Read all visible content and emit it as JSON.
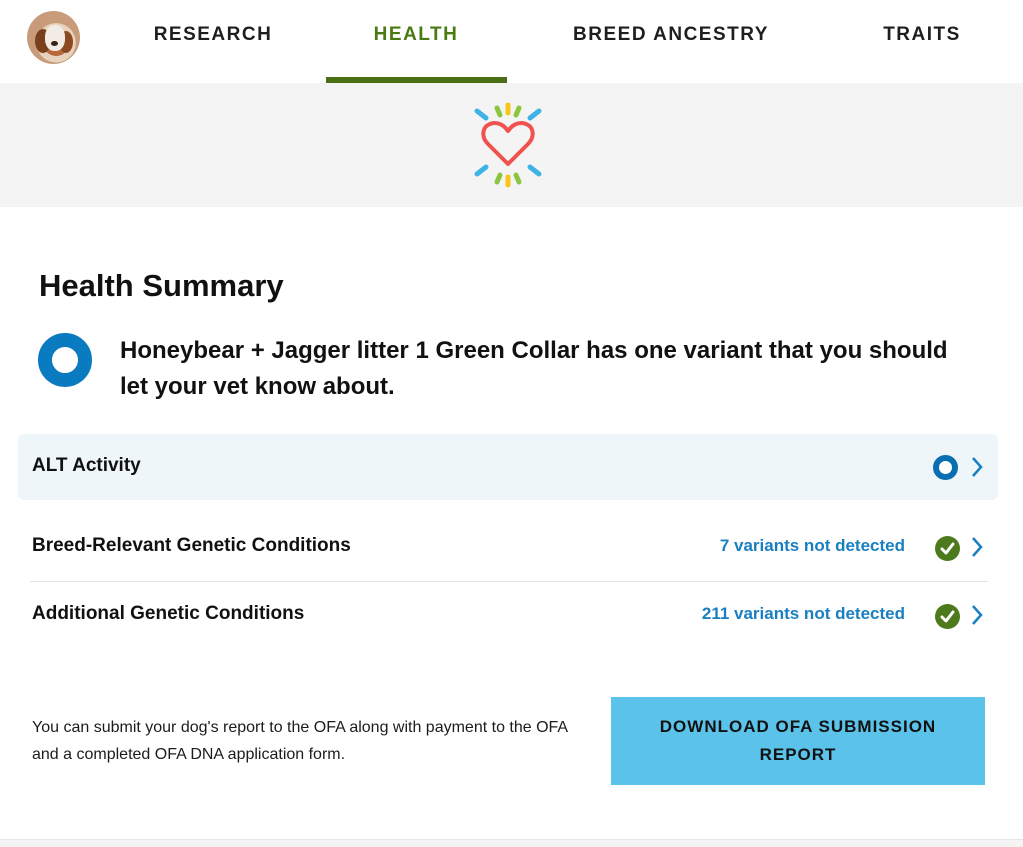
{
  "nav": {
    "tabs": [
      {
        "label": "RESEARCH",
        "active": false
      },
      {
        "label": "HEALTH",
        "active": true
      },
      {
        "label": "BREED ANCESTRY",
        "active": false
      },
      {
        "label": "TRAITS",
        "active": false
      }
    ]
  },
  "banner": {
    "icon": "heart-burst-icon"
  },
  "health": {
    "title": "Health Summary",
    "summary": "Honeybear + Jagger litter 1 Green Collar has one variant that you should let your vet know about."
  },
  "rows": [
    {
      "label": "ALT Activity",
      "count": "",
      "status": "notable"
    },
    {
      "label": "Breed-Relevant Genetic Conditions",
      "count": "7 variants not detected",
      "status": "clear"
    },
    {
      "label": "Additional Genetic Conditions",
      "count": "211 variants not detected",
      "status": "clear"
    }
  ],
  "ofa": {
    "text": "You can submit your dog's report to the OFA along with payment to the OFA and a completed OFA DNA application form.",
    "button_label": "DOWNLOAD OFA SUBMISSION REPORT"
  },
  "colors": {
    "active_tab": "#4a7a12",
    "accent_blue": "#0a7bc0",
    "count_blue": "#1a7fc0",
    "ok_green": "#4d7a1c",
    "button_bg": "#5bc2ea"
  }
}
